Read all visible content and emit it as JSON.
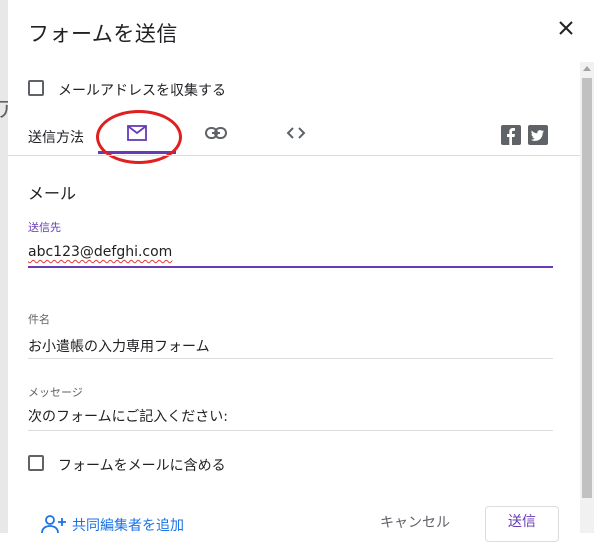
{
  "dialog": {
    "title": "フォームを送信",
    "collect_email_label": "メールアドレスを収集する",
    "send_via_label": "送信方法",
    "tabs": [
      {
        "icon": "email-icon",
        "active": true
      },
      {
        "icon": "link-icon",
        "active": false
      },
      {
        "icon": "embed-code-icon",
        "active": false
      }
    ],
    "social": [
      "facebook-icon",
      "twitter-icon"
    ],
    "accent_color": "#673ab7",
    "email_section": {
      "title": "メール",
      "to": {
        "label": "送信先",
        "value": "abc123@defghi.com"
      },
      "subject": {
        "label": "件名",
        "value": "お小遣帳の入力専用フォーム"
      },
      "message": {
        "label": "メッセージ",
        "value": "次のフォームにご記入ください:"
      },
      "include_form_label": "フォームをメールに含める"
    },
    "footer": {
      "add_collaborators": "共同編集者を追加",
      "cancel": "キャンセル",
      "send": "送信"
    }
  }
}
